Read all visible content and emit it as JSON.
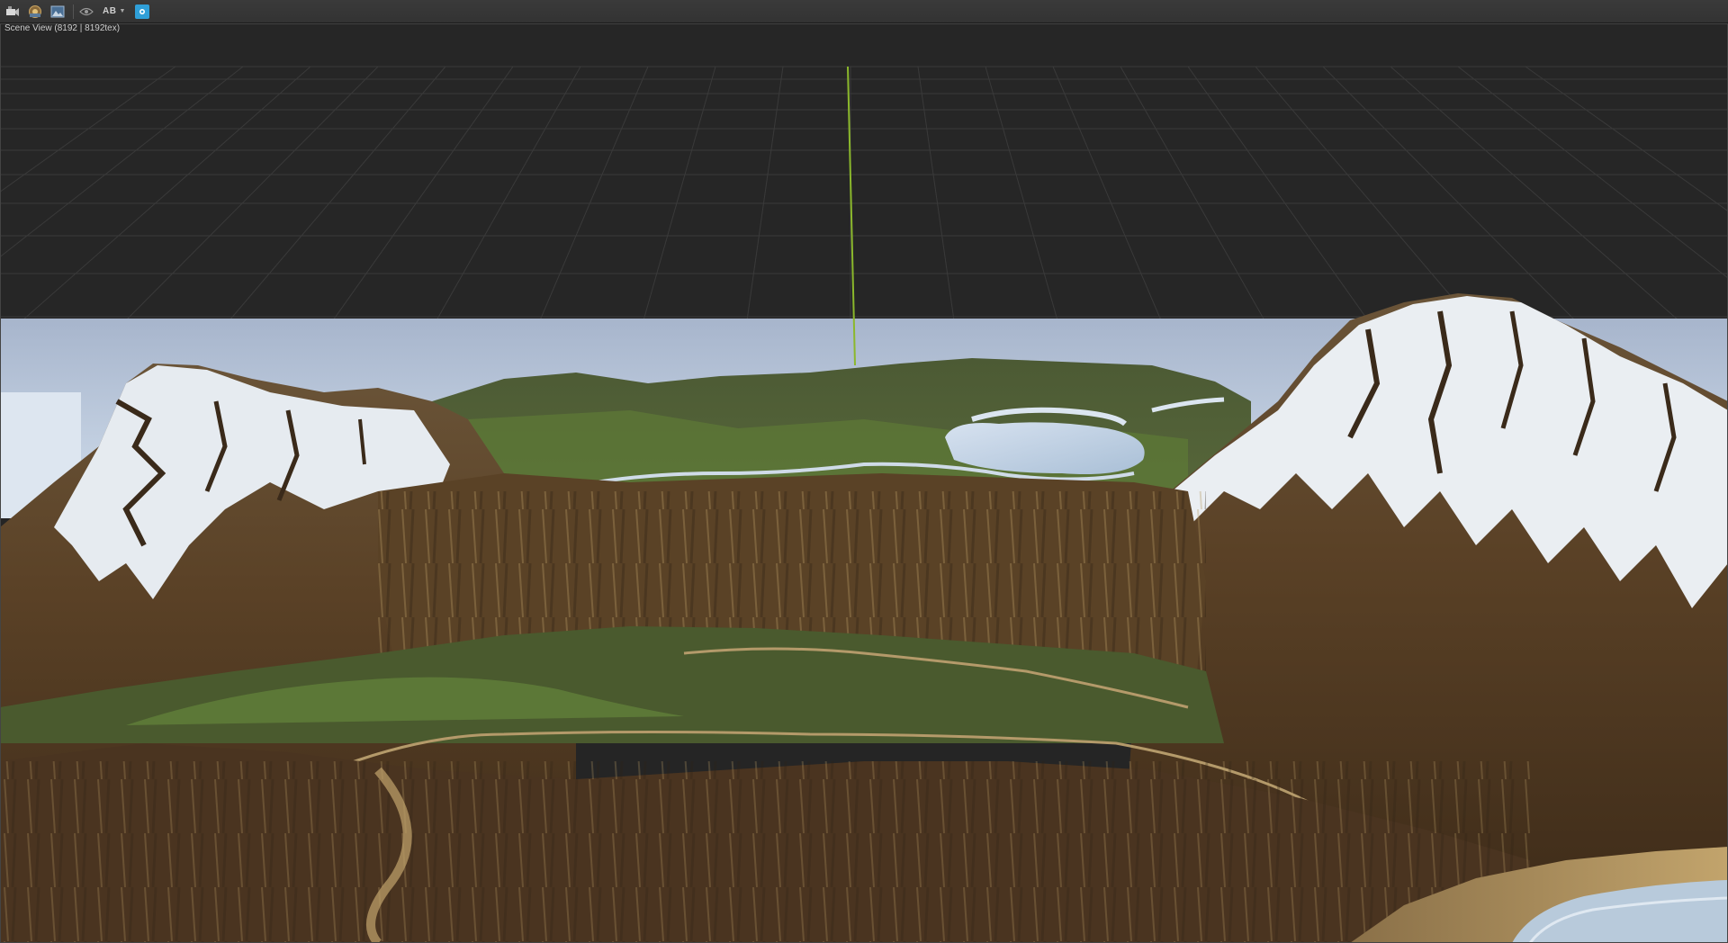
{
  "toolbar": {
    "buttons": [
      {
        "icon": "camera-icon"
      },
      {
        "icon": "render-settings-icon"
      },
      {
        "icon": "image-icon"
      },
      {
        "icon": "eye-icon"
      },
      {
        "icon": "ab-compare-icon",
        "label": "AB"
      },
      {
        "icon": "viewport-toggle-icon"
      }
    ],
    "ab_label": "AB",
    "accent_color": "#2f9fd8"
  },
  "viewport": {
    "label": "Scene View (8192 | 8192tex)"
  }
}
